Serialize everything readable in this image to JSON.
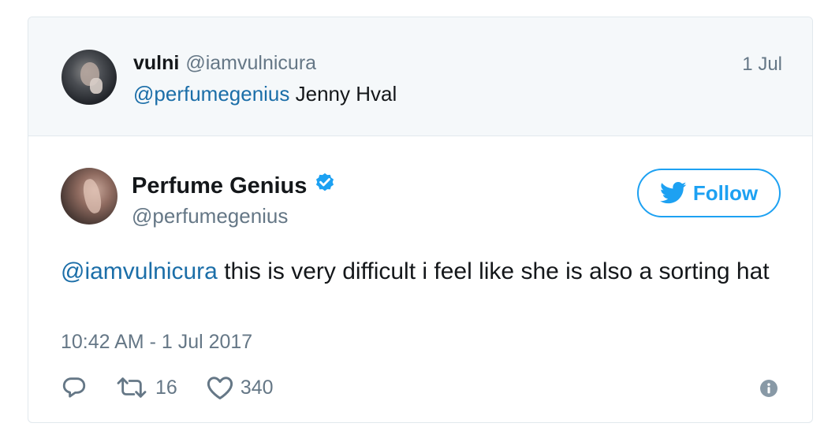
{
  "parent_tweet": {
    "author_name": "vulni",
    "author_handle": "@iamvulnicura",
    "date": "1 Jul",
    "mention": "@perfumegenius",
    "text": " Jenny Hval"
  },
  "tweet": {
    "author_name": "Perfume Genius",
    "author_handle": "@perfumegenius",
    "follow_label": "Follow",
    "mention": "@iamvulnicura",
    "text": " this is very difficult i feel like she is also a sorting hat",
    "timestamp": "10:42 AM - 1 Jul 2017",
    "retweet_count": "16",
    "like_count": "340"
  },
  "colors": {
    "link": "#1b6ea8",
    "accent": "#1da1f2",
    "muted": "#657786",
    "parent_bg": "#f5f8fa"
  },
  "icons": [
    "verified-badge-icon",
    "twitter-bird-icon",
    "reply-icon",
    "retweet-icon",
    "heart-icon",
    "info-icon"
  ]
}
